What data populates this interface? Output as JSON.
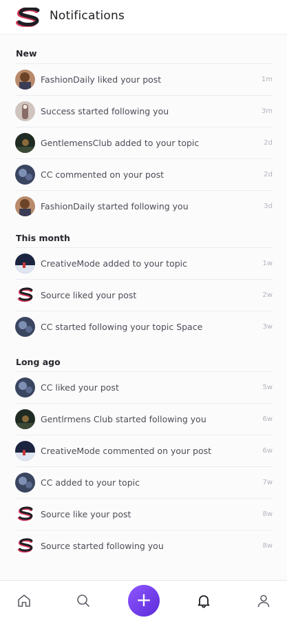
{
  "header": {
    "title": "Notifications",
    "logo_icon": "source-logo"
  },
  "sections": [
    {
      "label": "New"
    },
    {
      "label": "This month"
    },
    {
      "label": "Long ago"
    }
  ],
  "notifications": [
    {
      "text": "FashionDaily liked your post",
      "time": "1m",
      "avatar": "fashiondaily"
    },
    {
      "text": "Success started following you",
      "time": "3m",
      "avatar": "success"
    },
    {
      "text": "GentlemensClub added to your topic",
      "time": "2d",
      "avatar": "gentlemensclub"
    },
    {
      "text": "CC commented on your post",
      "time": "2d",
      "avatar": "cc"
    },
    {
      "text": "FashionDaily started following you",
      "time": "3d",
      "avatar": "fashiondaily"
    },
    {
      "text": "CreativeMode added to your topic",
      "time": "1w",
      "avatar": "creativemode"
    },
    {
      "text": "Source liked your post",
      "time": "2w",
      "avatar": "source"
    },
    {
      "text": "CC started following your topic Space",
      "time": "3w",
      "avatar": "cc"
    },
    {
      "text": "CC liked your post",
      "time": "5w",
      "avatar": "cc"
    },
    {
      "text": "Gentlrmens Club started following you",
      "time": "6w",
      "avatar": "gentlemensclub"
    },
    {
      "text": "CreativeMode commented on your post",
      "time": "6w",
      "avatar": "creativemode"
    },
    {
      "text": "CC added to your topic",
      "time": "7w",
      "avatar": "cc"
    },
    {
      "text": "Source like your post",
      "time": "8w",
      "avatar": "source"
    },
    {
      "text": "Source started following you",
      "time": "8w",
      "avatar": "source"
    }
  ],
  "nav": {
    "items": [
      "home-icon",
      "search-icon",
      "add-icon",
      "bell-icon",
      "profile-icon"
    ],
    "fab_label": "+",
    "accent": "#7a45f0"
  }
}
